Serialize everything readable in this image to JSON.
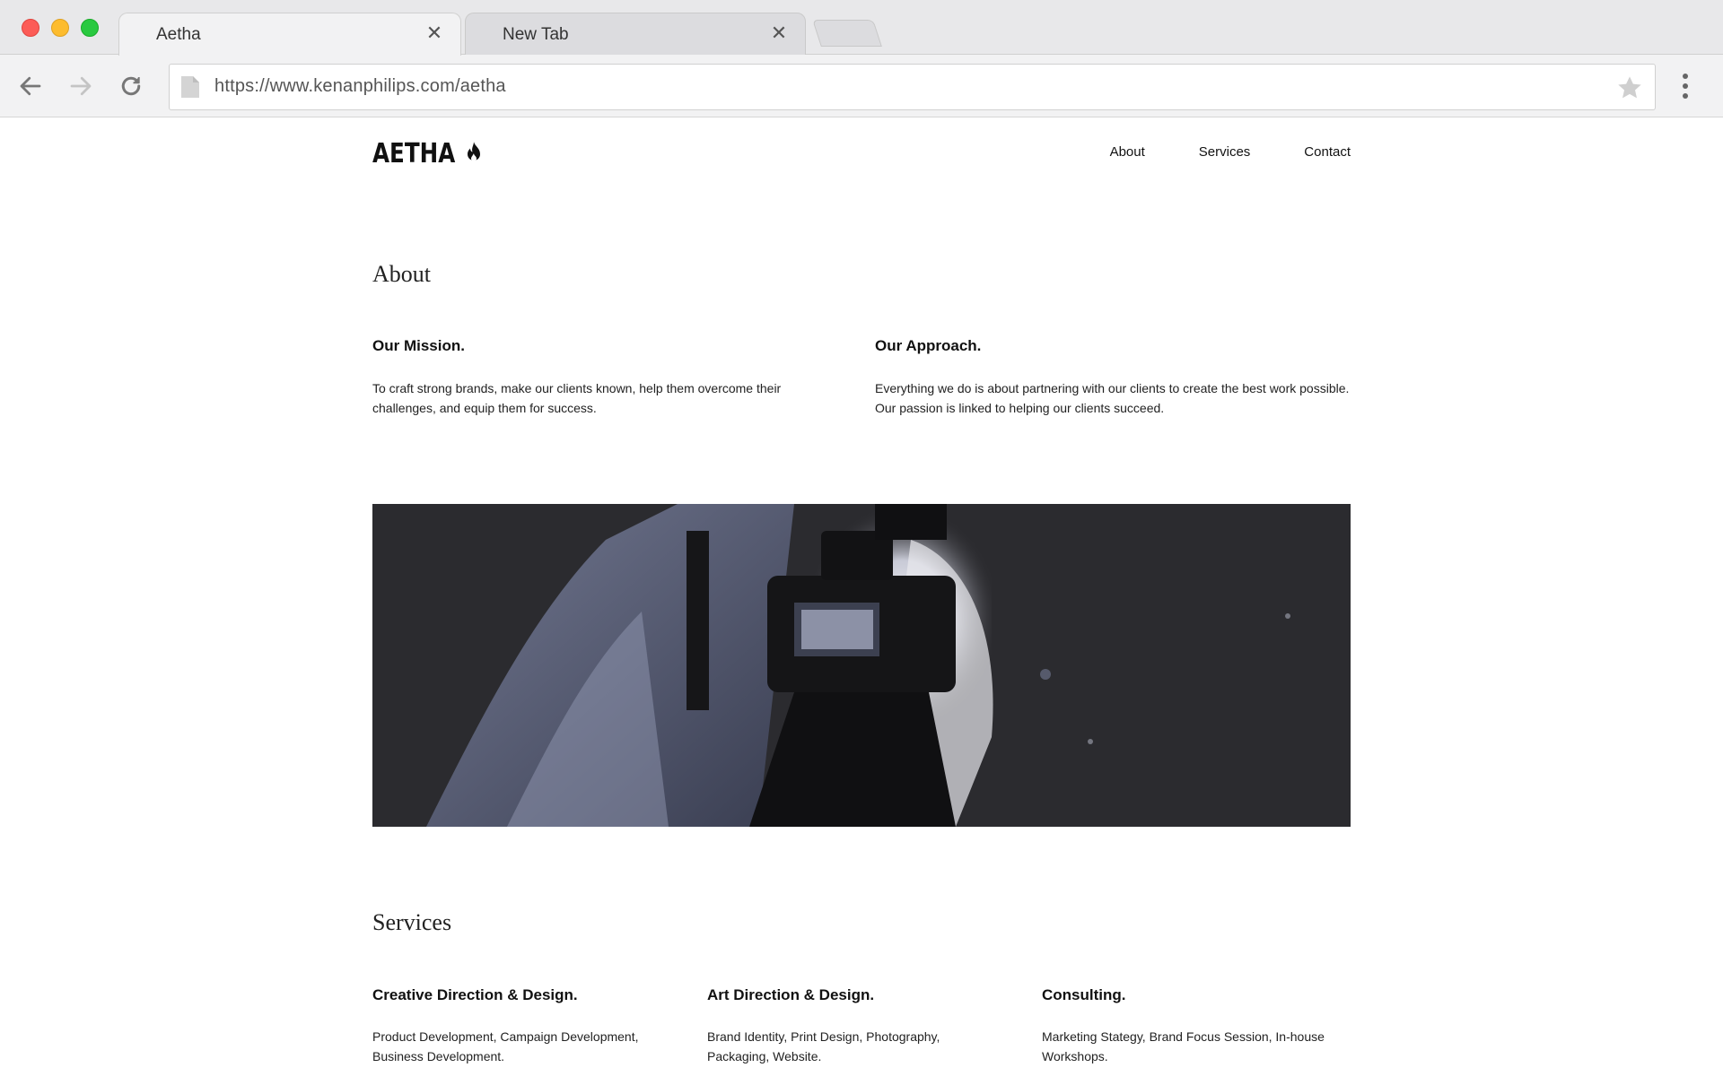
{
  "browser": {
    "tabs": [
      {
        "title": "Aetha",
        "active": true
      },
      {
        "title": "New Tab",
        "active": false
      }
    ],
    "close_glyph": "✕",
    "url": "https://www.kenanphilips.com/aetha"
  },
  "site": {
    "logo": "AETHA",
    "nav": [
      "About",
      "Services",
      "Contact"
    ]
  },
  "about": {
    "title": "About",
    "columns": [
      {
        "heading": "Our Mission.",
        "body": "To craft strong brands, make our clients known, help them overcome their challenges, and equip them for success."
      },
      {
        "heading": "Our Approach.",
        "body": "Everything we do is about partnering with our clients to create the best work possible. Our passion is linked to helping our clients succeed."
      }
    ]
  },
  "services": {
    "title": "Services",
    "columns": [
      {
        "heading": "Creative Direction & Design.",
        "body": "Product Development, Campaign Development, Business Development."
      },
      {
        "heading": "Art Direction & Design.",
        "body": "Brand Identity, Print Design, Photography, Packaging, Website."
      },
      {
        "heading": "Consulting.",
        "body": "Marketing Stategy, Brand Focus Session, In-house Workshops."
      }
    ]
  },
  "colors": {
    "traffic_red": "#fc5c57",
    "traffic_yellow": "#fdbc2e",
    "traffic_green": "#29c940",
    "text": "#111111",
    "hero_bg": "#2a2a2e"
  },
  "icons": [
    "back-arrow-icon",
    "forward-arrow-icon",
    "reload-icon",
    "page-icon",
    "bookmark-star-icon",
    "more-vert-icon",
    "flame-icon",
    "close-icon"
  ]
}
